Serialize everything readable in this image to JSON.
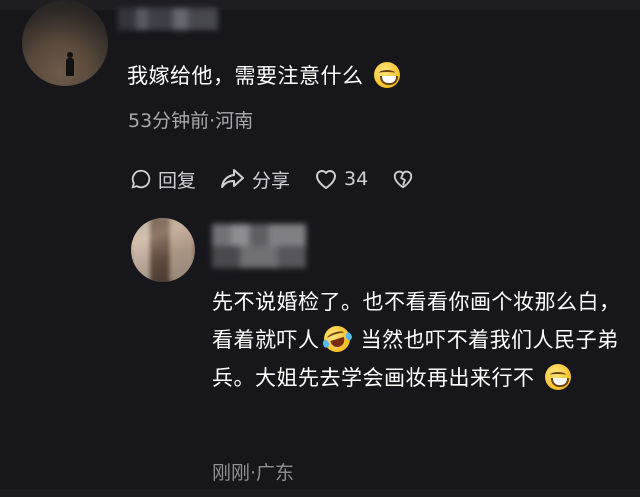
{
  "comment1": {
    "text": "我嫁给他，需要注意什么",
    "emoji": "grinning-face-emoji",
    "meta": "53分钟前·河南"
  },
  "actions": {
    "reply_label": "回复",
    "share_label": "分享",
    "like_count": "34"
  },
  "comment2": {
    "text_part1": "先不说婚检了。也不看看你画个妆那么白，看着就吓人",
    "emoji1": "rolling-on-floor-laughing-emoji",
    "text_part2": " 当然也吓不着我们人民子弟兵。大姐先去学会画妆再出来行不",
    "emoji2": "grinning-sweat-emoji",
    "meta": "刚刚·广东"
  },
  "colors": {
    "background": "#16161b",
    "text_primary": "#ffffff",
    "text_secondary": "#a8a8ad"
  }
}
